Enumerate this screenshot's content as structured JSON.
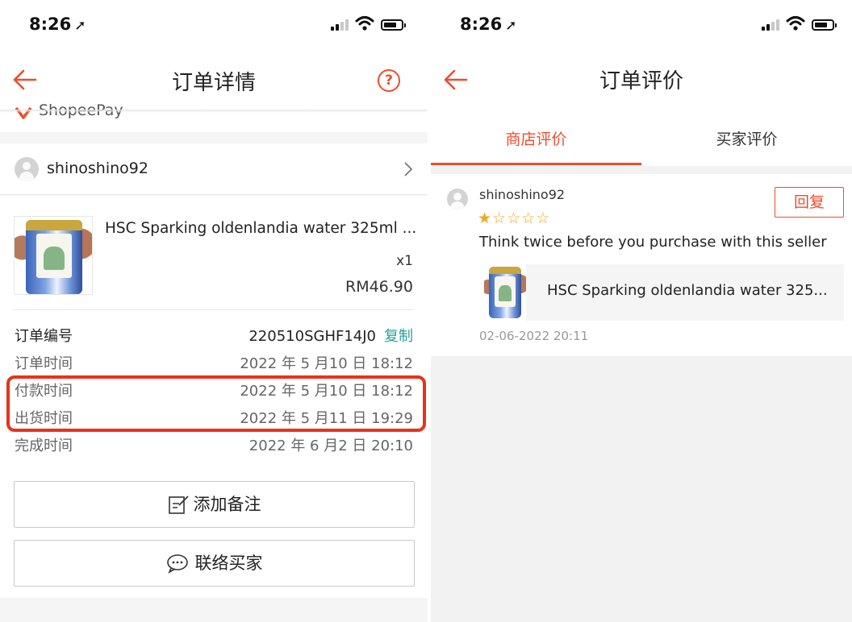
{
  "left": {
    "status_bar": {
      "time": "8:26",
      "time_icon": "location-arrow-icon"
    },
    "nav": {
      "title": "订单详情",
      "back_icon": "back-arrow-icon",
      "help_icon": "help-circle-icon",
      "help_glyph": "?"
    },
    "payment": {
      "label": "ShopeePay",
      "icon": "shopeepay-icon"
    },
    "buyer": {
      "name": "shinoshino92",
      "avatar_icon": "user-avatar-icon",
      "chevron_icon": "chevron-right-icon"
    },
    "product": {
      "title": "HSC Sparking oldenlandia water 325ml ...",
      "qty": "x1",
      "price": "RM46.90"
    },
    "order_info": [
      {
        "key": "订单编号",
        "value": "220510SGHF14J0",
        "action": "复制"
      },
      {
        "key": "订单时间",
        "value": "2022 年 5 月10 日  18:12"
      },
      {
        "key": "付款时间",
        "value": "2022 年 5 月10 日  18:12"
      },
      {
        "key": "出货时间",
        "value": "2022 年 5 月11 日  19:29"
      },
      {
        "key": "完成时间",
        "value": "2022 年 6 月2 日  20:10"
      }
    ],
    "actions": {
      "add_note": "添加备注",
      "add_note_icon": "note-edit-icon",
      "contact_buyer": "联络买家",
      "contact_icon": "chat-bubble-icon"
    }
  },
  "right": {
    "status_bar": {
      "time": "8:26"
    },
    "nav": {
      "title": "订单评价",
      "back_icon": "back-arrow-icon"
    },
    "tabs": [
      {
        "label": "商店评价",
        "active": true
      },
      {
        "label": "买家评价",
        "active": false
      }
    ],
    "review": {
      "user": "shinoshino92",
      "rating": 1,
      "max_rating": 5,
      "reply_label": "回复",
      "text": "Think twice before you purchase with this seller",
      "product_title": "HSC Sparking oldenlandia water 325...",
      "date": "02-06-2022 20:11"
    }
  },
  "colors": {
    "accent": "#ee4d2d",
    "copy_link": "#23a393",
    "highlight_box": "#e8321b"
  }
}
